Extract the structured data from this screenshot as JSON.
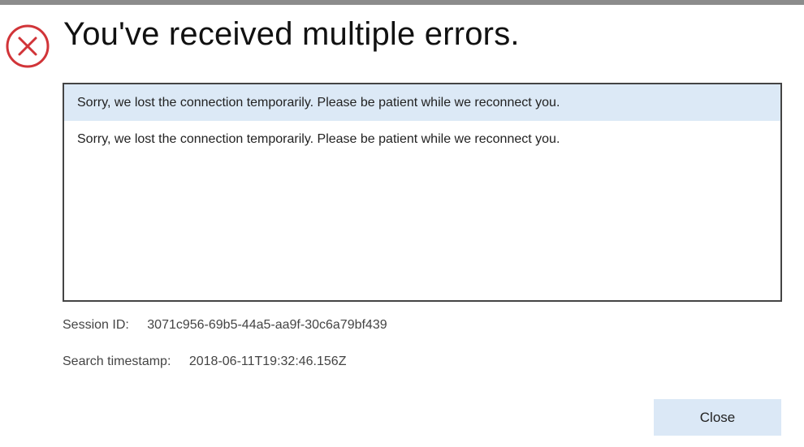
{
  "dialog": {
    "title": "You've received multiple errors.",
    "icon": "error-circle-x-icon",
    "accent_color": "#d13438",
    "errors": [
      {
        "message": "Sorry, we lost the connection temporarily. Please be patient while we reconnect you.",
        "selected": true
      },
      {
        "message": "Sorry, we lost the connection temporarily. Please be patient while we reconnect you.",
        "selected": false
      }
    ],
    "session": {
      "label": "Session ID:",
      "value": "3071c956-69b5-44a5-aa9f-30c6a79bf439"
    },
    "timestamp": {
      "label": "Search timestamp:",
      "value": "2018-06-11T19:32:46.156Z"
    },
    "close_label": "Close"
  }
}
